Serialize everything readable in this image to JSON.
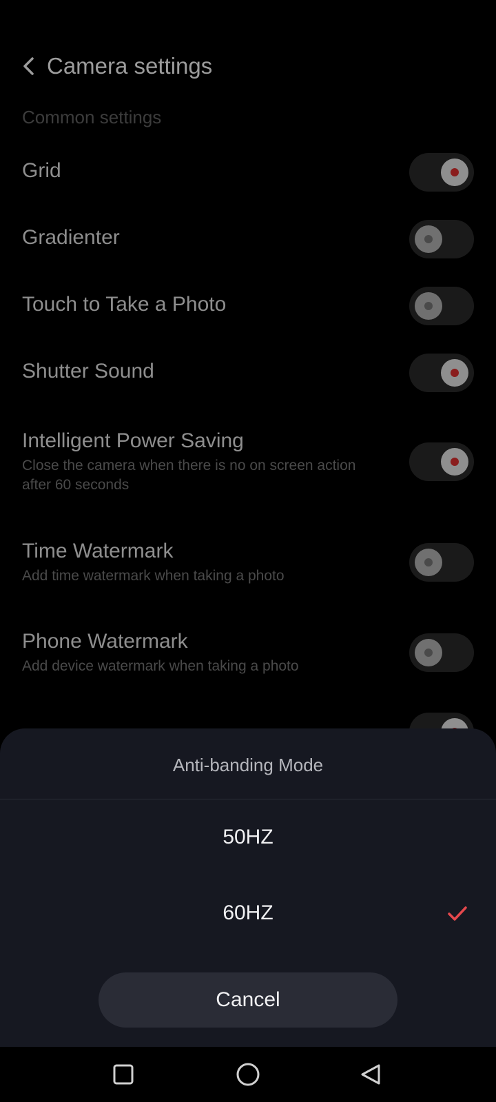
{
  "header": {
    "title": "Camera settings",
    "back_icon": "chevron-left-icon"
  },
  "section": {
    "title": "Common settings"
  },
  "settings": [
    {
      "title": "Grid",
      "subtitle": "",
      "enabled": true
    },
    {
      "title": "Gradienter",
      "subtitle": "",
      "enabled": false
    },
    {
      "title": "Touch to Take a Photo",
      "subtitle": "",
      "enabled": false
    },
    {
      "title": "Shutter Sound",
      "subtitle": "",
      "enabled": true
    },
    {
      "title": "Intelligent Power Saving",
      "subtitle": "Close the camera when there is no on screen action after 60 seconds",
      "enabled": true
    },
    {
      "title": "Time Watermark",
      "subtitle": "Add time watermark when taking a photo",
      "enabled": false
    },
    {
      "title": "Phone Watermark",
      "subtitle": "Add device watermark when taking a photo",
      "enabled": false
    }
  ],
  "sheet": {
    "title": "Anti-banding Mode",
    "options": [
      {
        "label": "50HZ",
        "selected": false
      },
      {
        "label": "60HZ",
        "selected": true
      }
    ],
    "cancel_label": "Cancel",
    "check_color": "#e5484d"
  },
  "navbar": {
    "recents_icon": "square-icon",
    "home_icon": "circle-icon",
    "back_icon": "triangle-back-icon"
  },
  "colors": {
    "background": "#000000",
    "sheet_background": "#161821",
    "accent": "#e5484d"
  }
}
